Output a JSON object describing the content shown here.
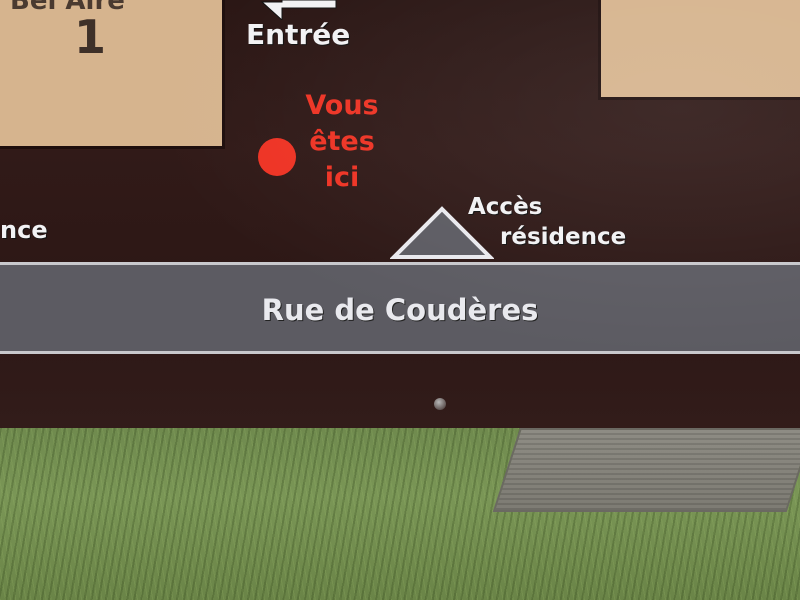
{
  "sign": {
    "building_name": "Bel Aire",
    "building_number": "1",
    "entrance": "Entrée",
    "you_are_here": [
      "Vous",
      "êtes",
      "ici"
    ],
    "access": [
      "Accès",
      "résidence"
    ],
    "edge_text": "nce",
    "street": "Rue de Coudères"
  },
  "colors": {
    "board": "#2c1715",
    "building": "#d6b48e",
    "street_band": "#5c5b62",
    "you_are_here": "#ee3324",
    "grass": "#7a9656"
  },
  "icons": {
    "entrance": "left-arrow-icon",
    "location": "red-dot-icon",
    "access": "triangle-icon"
  }
}
